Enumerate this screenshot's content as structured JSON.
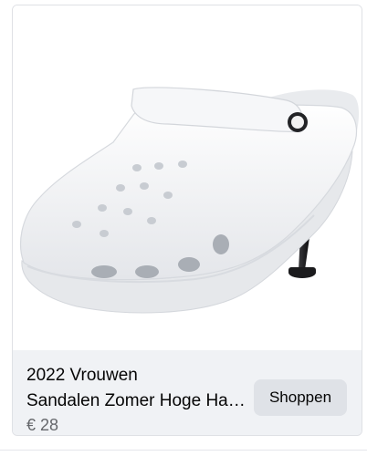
{
  "listing": {
    "title_line1": "2022 Vrouwen",
    "title_line2": "Sandalen Zomer Hoge Hakken",
    "price": "€ 28",
    "cta_label": "Shoppen"
  },
  "image": {
    "subject_icon": "high-heel-clog-icon",
    "shoe_color": "#f4f5f7",
    "heel_color": "#1b1b1d"
  },
  "colors": {
    "info_background": "#f0f2f5",
    "button_background": "#dfe2e7",
    "price_text": "#65676b"
  }
}
